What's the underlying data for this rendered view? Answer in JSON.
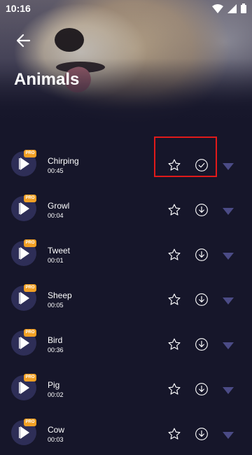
{
  "status_bar": {
    "time": "10:16"
  },
  "header": {
    "title": "Animals"
  },
  "colors": {
    "background": "#16162a",
    "badge": "#f2a024",
    "caret": "#4b4b86",
    "highlight": "#e01a1a"
  },
  "badge_label": "PRO",
  "sounds": [
    {
      "name": "Chirping",
      "duration": "00:45",
      "action": "check"
    },
    {
      "name": "Growl",
      "duration": "00:04",
      "action": "download"
    },
    {
      "name": "Tweet",
      "duration": "00:01",
      "action": "download"
    },
    {
      "name": "Sheep",
      "duration": "00:05",
      "action": "download"
    },
    {
      "name": "Bird",
      "duration": "00:36",
      "action": "download"
    },
    {
      "name": "Pig",
      "duration": "00:02",
      "action": "download"
    },
    {
      "name": "Cow",
      "duration": "00:03",
      "action": "download"
    }
  ]
}
